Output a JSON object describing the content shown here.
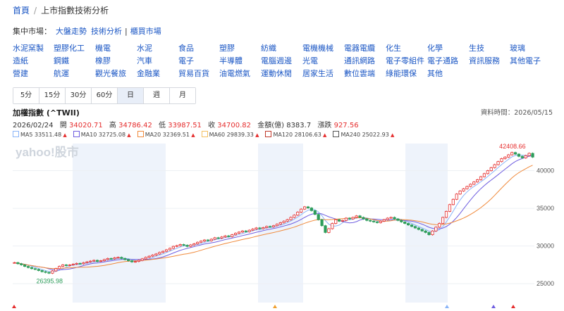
{
  "breadcrumb": {
    "home": "首頁",
    "current": "上市指數技術分析"
  },
  "market": {
    "label": "集中市場：",
    "links": [
      "大盤走勢",
      "技術分析"
    ],
    "otc": "櫃買市場"
  },
  "sectors": [
    [
      "水泥窯製",
      "塑膠化工",
      "機電",
      "水泥",
      "食品",
      "塑膠",
      "紡織",
      "電機機械",
      "電器電纜",
      "化生",
      "化學",
      "生技",
      "玻璃"
    ],
    [
      "造紙",
      "鋼鐵",
      "橡膠",
      "汽車",
      "電子",
      "半導體",
      "電腦週邊",
      "光電",
      "通訊網路",
      "電子零組件",
      "電子通路",
      "資訊服務",
      "其他電子"
    ],
    [
      "營建",
      "航運",
      "觀光餐旅",
      "金融業",
      "貿易百貨",
      "油電燃氣",
      "運動休閒",
      "居家生活",
      "數位雲端",
      "綠能環保",
      "其他"
    ]
  ],
  "tabs": [
    "5分",
    "15分",
    "30分",
    "60分",
    "日",
    "週",
    "月"
  ],
  "active_tab": "日",
  "chart": {
    "title": "加權指數 (^TWII)",
    "date_label": "資料時間：2026/05/15",
    "ohlc": {
      "date": "2026/02/24",
      "open_label": "開",
      "open": "34020.71",
      "high_label": "高",
      "high": "34786.42",
      "low_label": "低",
      "low": "33987.51",
      "close_label": "收",
      "close": "34700.82",
      "amount_label": "金額(億)",
      "amount": "8383.7",
      "change_label": "漲跌",
      "change": "927.56"
    },
    "ma": [
      {
        "label": "MA5",
        "value": "33511.48",
        "color": "#8ab4f8"
      },
      {
        "label": "MA10",
        "value": "32725.08",
        "color": "#6f5ee0"
      },
      {
        "label": "MA20",
        "value": "32369.51",
        "color": "#f08a3c"
      },
      {
        "label": "MA60",
        "value": "29839.33",
        "color": "#f4c060"
      },
      {
        "label": "MA120",
        "value": "28106.63",
        "color": "#c0392b"
      },
      {
        "label": "MA240",
        "value": "25022.93",
        "color": "#555555"
      }
    ],
    "watermark": "yahoo!股市",
    "colors": {
      "up": "#e52d2d",
      "down": "#2d9d5a",
      "band": "#eef3fb"
    }
  },
  "chart_data": {
    "type": "candlestick",
    "y_ticks": [
      25000,
      30000,
      35000,
      40000
    ],
    "ylim": [
      22500,
      43600
    ],
    "max_label": "42408.66",
    "min_label": "26395.98",
    "max_value": 42408.66,
    "min_value": 26395.98,
    "closes": [
      27800,
      27650,
      27500,
      27300,
      27150,
      27000,
      26900,
      26750,
      26600,
      26500,
      26395.98,
      26700,
      27000,
      27300,
      27500,
      27400,
      27500,
      27600,
      27700,
      27650,
      27800,
      27900,
      28000,
      28100,
      27950,
      28050,
      28200,
      28350,
      28300,
      28450,
      28500,
      28350,
      28200,
      28050,
      27900,
      27950,
      28100,
      28300,
      28500,
      28650,
      28800,
      28950,
      29150,
      29300,
      29500,
      29700,
      29950,
      30050,
      30200,
      30100,
      29950,
      30150,
      30300,
      30500,
      30650,
      30800,
      30700,
      30900,
      31100,
      31050,
      31200,
      31350,
      31250,
      31500,
      31700,
      31850,
      32000,
      31900,
      32100,
      32250,
      32400,
      32300,
      32450,
      32600,
      32550,
      32700,
      32900,
      33100,
      33300,
      33500,
      33800,
      34100,
      34500,
      34900,
      35200,
      35050,
      34700,
      34200,
      33500,
      32700,
      31800,
      32300,
      33000,
      33500,
      33300,
      33400,
      33700,
      33600,
      33800,
      34000,
      33800,
      33600,
      33400,
      33300,
      33200,
      33100,
      33300,
      33500,
      33700,
      33800,
      33600,
      33400,
      33200,
      33000,
      32800,
      32600,
      32400,
      32200,
      32000,
      31800,
      31500,
      32000,
      32500,
      33000,
      33800,
      34600,
      35500,
      36200,
      36900,
      37300,
      37600,
      37900,
      38200,
      38500,
      38800,
      39200,
      39600,
      40000,
      40400,
      40800,
      41200,
      41600,
      41800,
      42100,
      42408.66,
      42200,
      41900,
      41700,
      42000,
      42300,
      41800
    ]
  }
}
